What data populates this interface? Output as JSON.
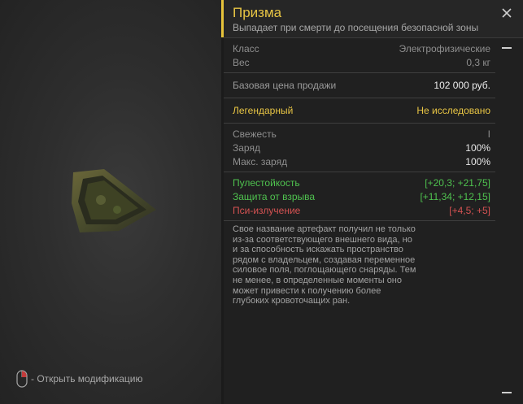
{
  "left": {
    "hint_text": "- Открыть модификацию",
    "icons": {
      "hint": "mouse-icon",
      "artifact": "artifact-image"
    }
  },
  "item": {
    "title": "Призма",
    "subtitle": "Выпадает при смерти до посещения безопасной зоны",
    "rows_basic": [
      {
        "label": "Класс",
        "value": "Электрофизические"
      },
      {
        "label": "Вес",
        "value": "0,3 кг"
      }
    ],
    "price": {
      "label": "Базовая цена продажи",
      "value": "102 000 руб."
    },
    "rarity": {
      "label": "Легендарный",
      "value": "Не исследовано"
    },
    "stats": [
      {
        "label": "Свежесть",
        "value": "I"
      },
      {
        "label": "Заряд",
        "value": "100%"
      },
      {
        "label": "Макс. заряд",
        "value": "100%"
      }
    ],
    "effects": [
      {
        "label": "Пулестойкость",
        "value": "[+20,3; +21,75]"
      },
      {
        "label": "Защита от взрыва",
        "value": "[+11,34; +12,15]"
      },
      {
        "label": "Пси-излучение",
        "value": "[+4,5; +5]"
      }
    ],
    "description": "Свое название артефакт получил не только из-за соответствующего внешнего вида, но и за способность искажать пространство рядом с владельцем, создавая переменное силовое поля, поглощающего снаряды. Тем не менее, в определенные моменты оно может привести к получению более глубоких кровоточащих ран."
  },
  "colors": {
    "accent": "#e8c544",
    "positive": "#4fc24f",
    "negative": "#d55252"
  },
  "icons": {
    "close": "close-icon"
  }
}
